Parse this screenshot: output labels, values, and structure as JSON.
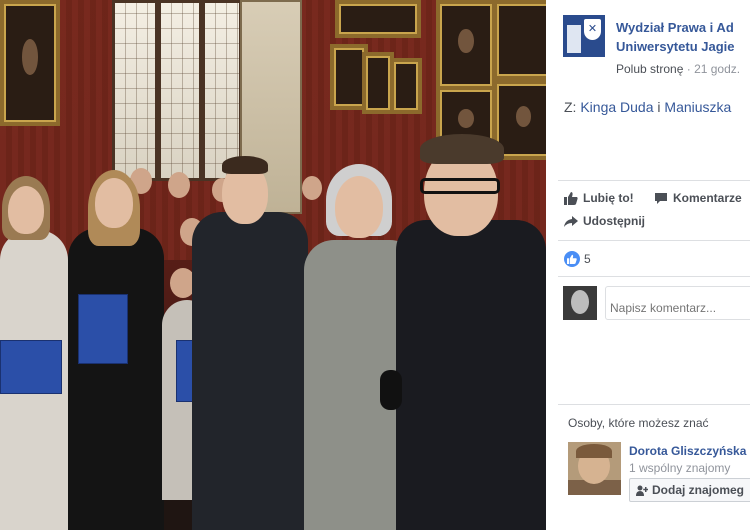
{
  "post": {
    "page_name_line1": "Wydział Prawa i Ad",
    "page_name_line2": "Uniwersytetu Jagie",
    "follow_label": "Polub stronę",
    "separator": " · ",
    "time": "21 godz.",
    "from_prefix": "Z: ",
    "author1": "Kinga Duda",
    "author_join": " i ",
    "author2": "Maniuszka"
  },
  "actions": {
    "like_label": "Lubię to!",
    "comment_label": "Komentarze",
    "share_label": "Udostępnij"
  },
  "reactions": {
    "count": "5"
  },
  "comment": {
    "placeholder": "Napisz komentarz..."
  },
  "people_you_may_know": {
    "title": "Osoby, które możesz znać",
    "name": "Dorota Gliszczyńska",
    "mutual": "1 wspólny znajomy",
    "add_label": "Dodaj znajomeg"
  },
  "colors": {
    "link": "#365899",
    "muted": "#90949c",
    "text": "#4b4f56",
    "like_blue": "#4a8ef5"
  }
}
